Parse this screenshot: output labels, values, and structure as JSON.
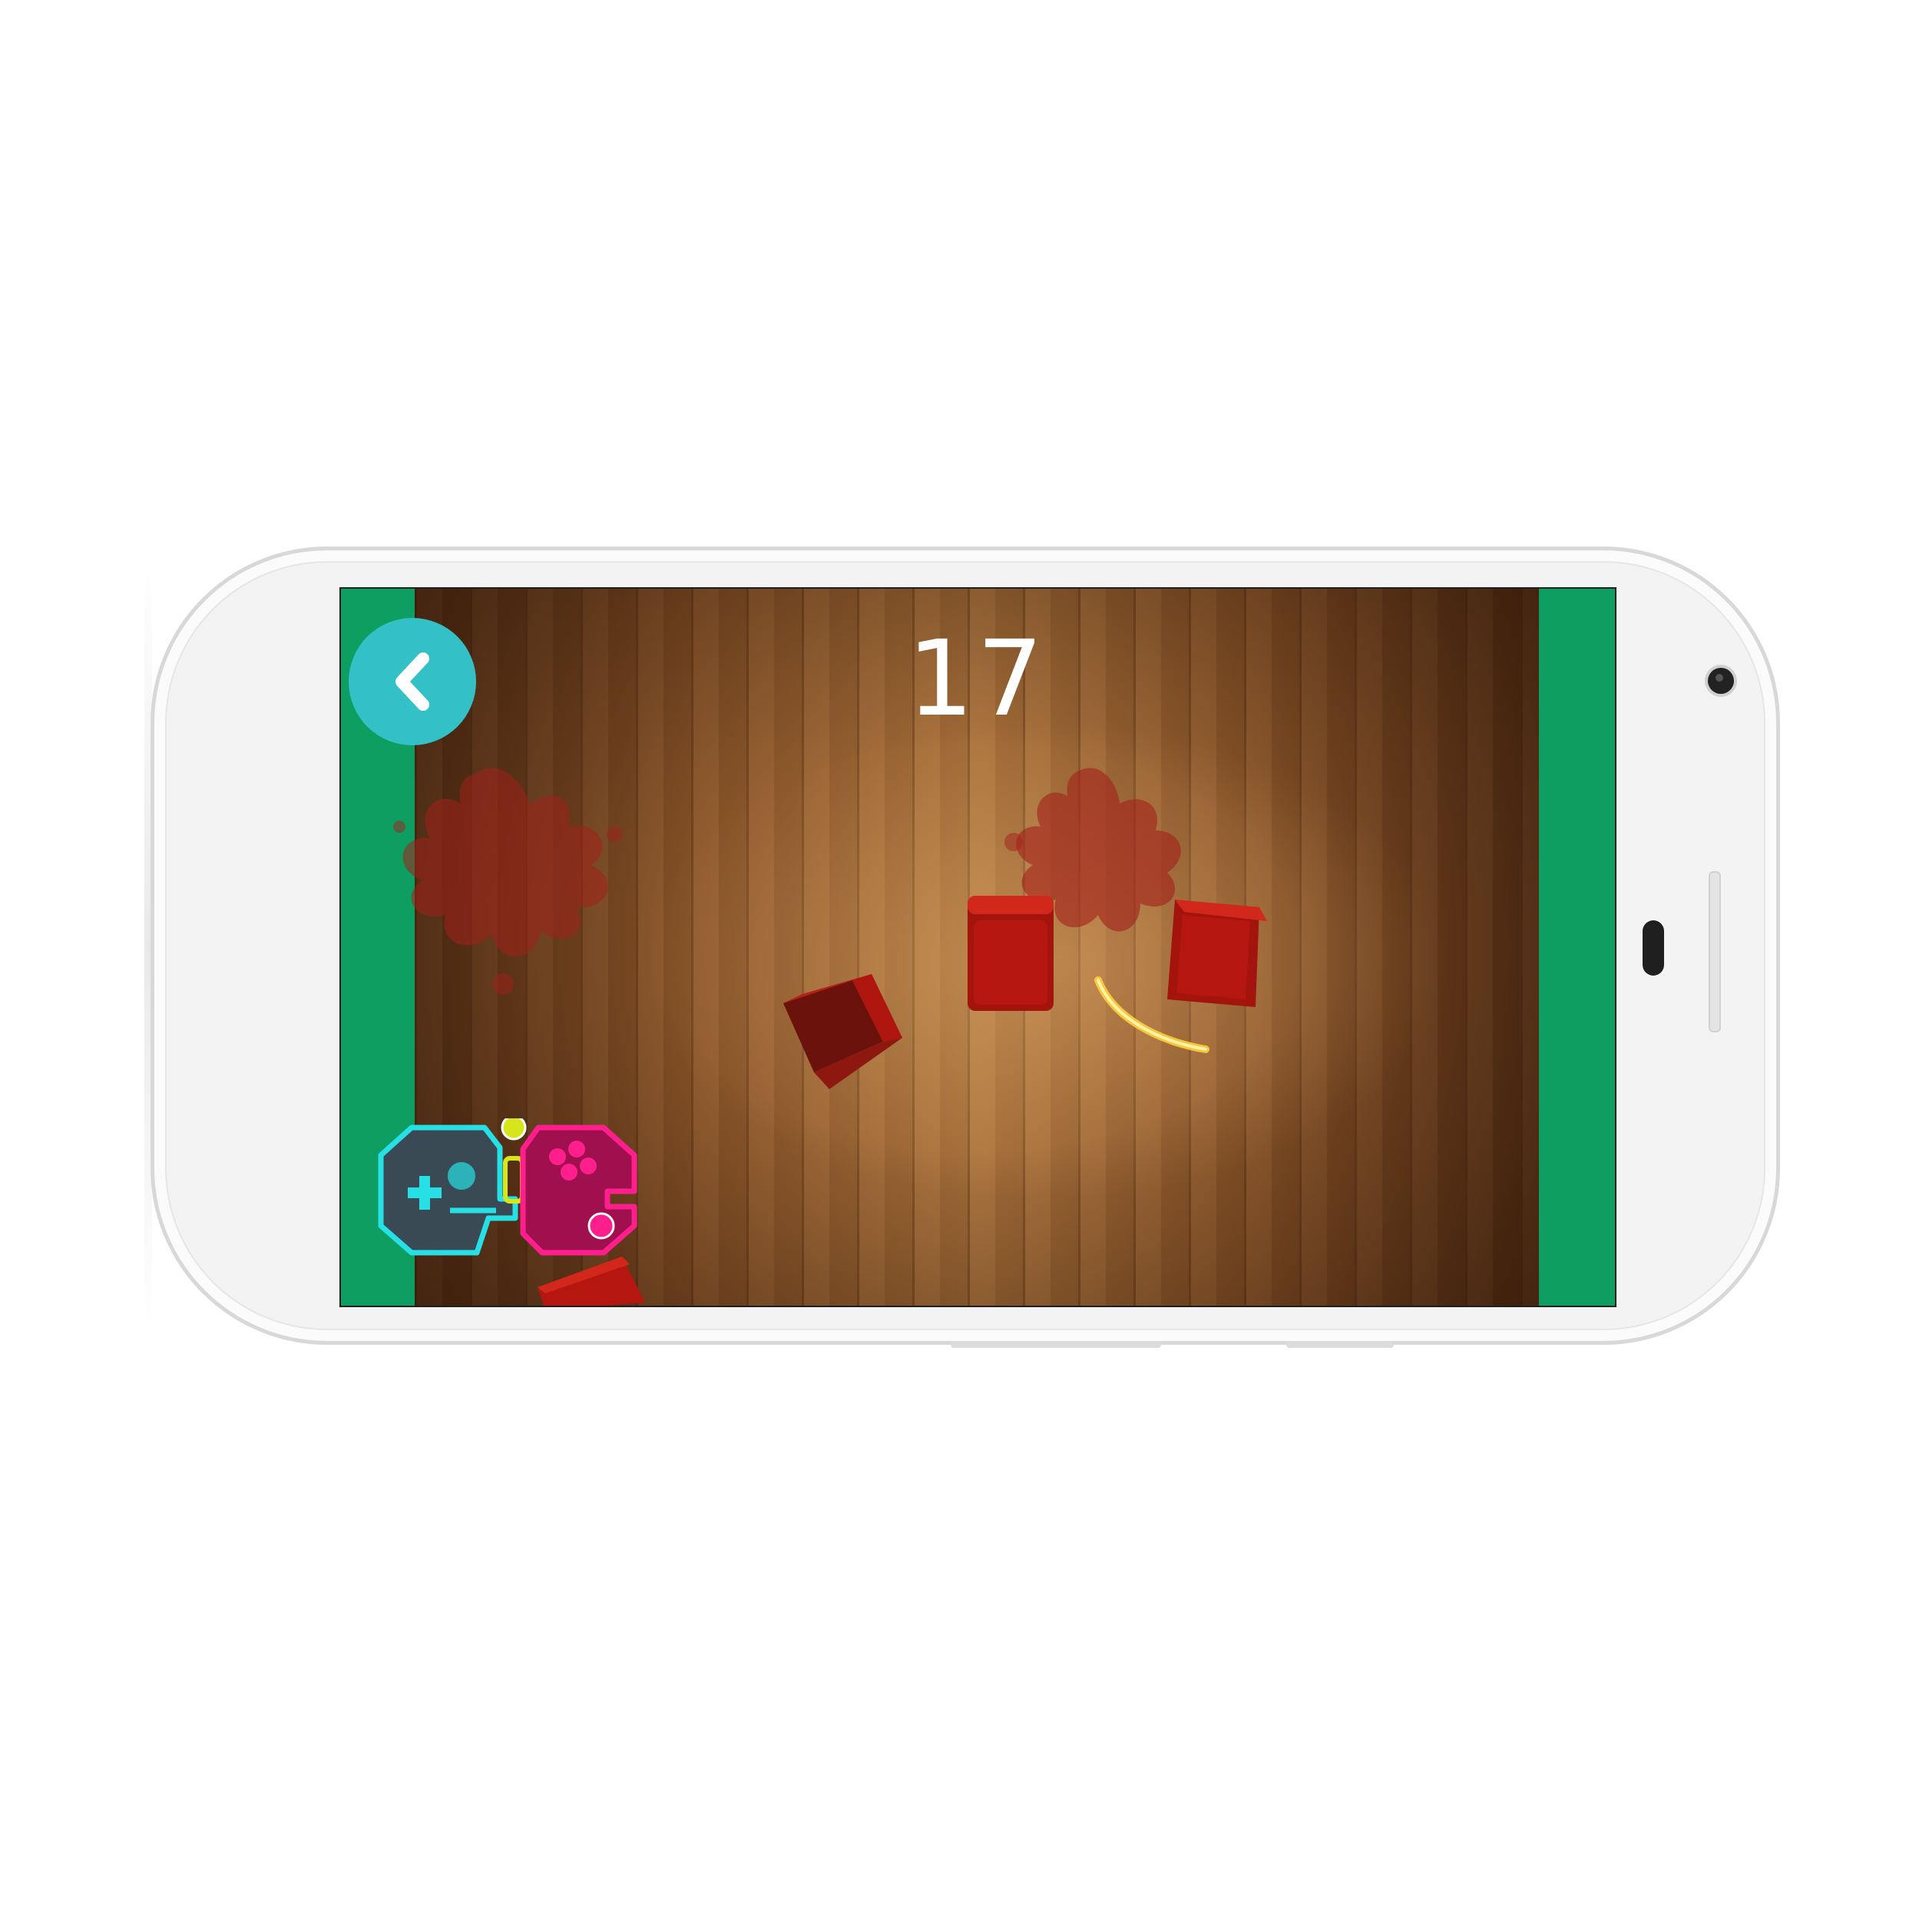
{
  "game": {
    "score": "17",
    "back_button_icon": "chevron-left-icon",
    "logo_icon": "game-controller-logo-icon"
  },
  "colors": {
    "side_panels": "#0f9e62",
    "back_button": "#33c0c6",
    "wood": "#8a5428",
    "fruit_red": "#b5160f",
    "splat_red": "#a3201a",
    "logo_cyan": "#27e0e6",
    "logo_magenta": "#ff1f8c",
    "logo_yellow": "#d6e61a"
  }
}
